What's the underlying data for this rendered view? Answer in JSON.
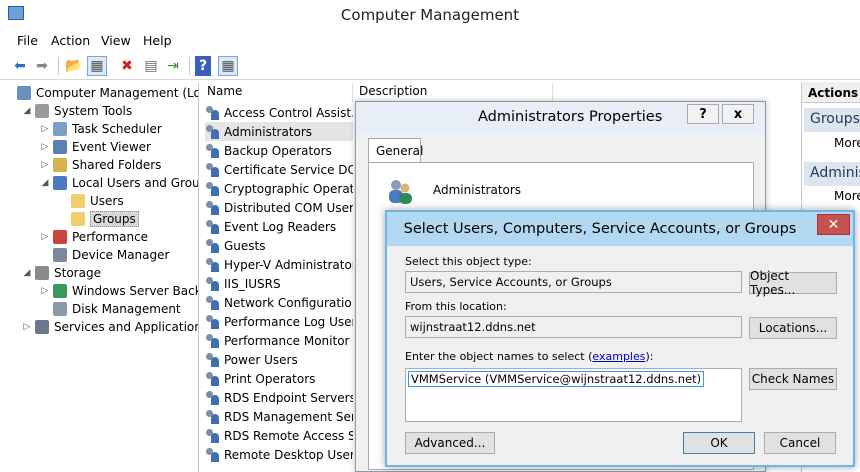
{
  "window": {
    "title": "Computer Management"
  },
  "menu": [
    "File",
    "Action",
    "View",
    "Help"
  ],
  "toolbar": {
    "buttons": [
      "back-icon",
      "forward-icon",
      "up-folder-icon",
      "show-hide-tree-icon",
      "delete-icon",
      "properties-icon",
      "export-icon",
      "help-icon",
      "show-hide-action-pane-icon"
    ]
  },
  "tree": [
    {
      "label": "Computer Management (Local",
      "expander": "",
      "icon": "computer-management-icon",
      "indent": 0
    },
    {
      "label": "System Tools",
      "expander": "◢",
      "icon": "tools-icon",
      "indent": 1
    },
    {
      "label": "Task Scheduler",
      "expander": "▷",
      "icon": "clock-icon",
      "indent": 2
    },
    {
      "label": "Event Viewer",
      "expander": "▷",
      "icon": "event-viewer-icon",
      "indent": 2
    },
    {
      "label": "Shared Folders",
      "expander": "▷",
      "icon": "shared-folder-icon",
      "indent": 2
    },
    {
      "label": "Local Users and Groups",
      "expander": "◢",
      "icon": "users-icon",
      "indent": 2
    },
    {
      "label": "Users",
      "expander": "",
      "icon": "folder-icon",
      "indent": 3
    },
    {
      "label": "Groups",
      "expander": "",
      "icon": "folder-icon",
      "indent": 3,
      "selected": true
    },
    {
      "label": "Performance",
      "expander": "▷",
      "icon": "performance-icon",
      "indent": 2
    },
    {
      "label": "Device Manager",
      "expander": "",
      "icon": "device-manager-icon",
      "indent": 2
    },
    {
      "label": "Storage",
      "expander": "◢",
      "icon": "storage-icon",
      "indent": 1
    },
    {
      "label": "Windows Server Backup",
      "expander": "▷",
      "icon": "backup-icon",
      "indent": 2
    },
    {
      "label": "Disk Management",
      "expander": "",
      "icon": "disk-icon",
      "indent": 2
    },
    {
      "label": "Services and Applications",
      "expander": "▷",
      "icon": "services-icon",
      "indent": 1
    }
  ],
  "list": {
    "columns": [
      "Name",
      "Description"
    ],
    "groups": [
      "Access Control Assist…",
      "Administrators",
      "Backup Operators",
      "Certificate Service DC…",
      "Cryptographic Operat…",
      "Distributed COM Users",
      "Event Log Readers",
      "Guests",
      "Hyper-V Administrators",
      "IIS_IUSRS",
      "Network Configuratio…",
      "Performance Log Users",
      "Performance Monitor …",
      "Power Users",
      "Print Operators",
      "RDS Endpoint Servers",
      "RDS Management Ser…",
      "RDS Remote Access S…",
      "Remote Desktop Users"
    ],
    "selected_index": 1
  },
  "actions": {
    "header": "Actions",
    "groups": [
      {
        "title": "Groups",
        "more": "More"
      },
      {
        "title": "Adminis",
        "more": "More"
      }
    ]
  },
  "properties_dialog": {
    "title": "Administrators Properties",
    "help_button": "?",
    "close_button": "x",
    "tab": "General",
    "group_name": "Administrators"
  },
  "select_dialog": {
    "title": "Select Users, Computers, Service Accounts, or Groups",
    "close_button": "✕",
    "object_type_label": "Select this object type:",
    "object_type_value": "Users, Service Accounts, or Groups",
    "object_types_button": "Object Types...",
    "location_label": "From this location:",
    "location_value": "wijnstraat12.ddns.net",
    "locations_button": "Locations...",
    "names_label_prefix": "Enter the object names to select (",
    "names_label_link": "examples",
    "names_label_suffix": "):",
    "names_value": "VMMService (VMMService@wijnstraat12.ddns.net)",
    "check_names_button": "Check Names",
    "advanced_button": "Advanced...",
    "ok_button": "OK",
    "cancel_button": "Cancel"
  }
}
